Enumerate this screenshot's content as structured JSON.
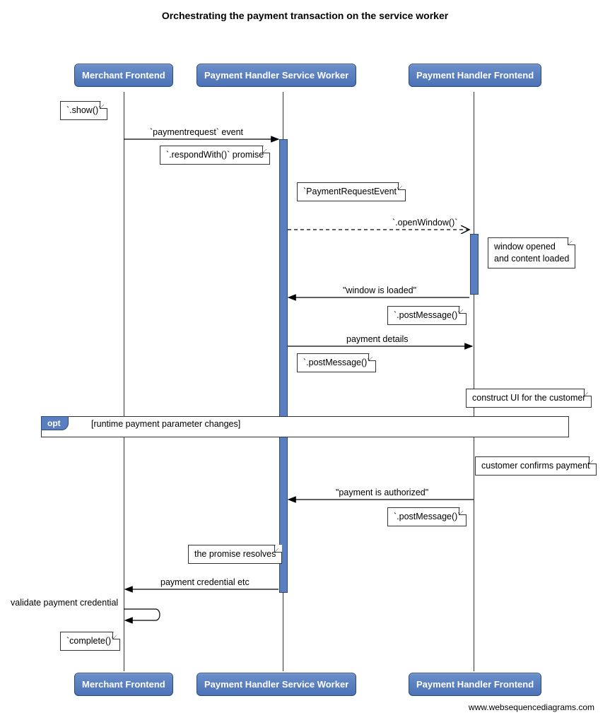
{
  "title": "Orchestrating the payment transaction on the service worker",
  "actors": {
    "merchant": "Merchant Frontend",
    "worker": "Payment Handler Service Worker",
    "frontend": "Payment Handler Frontend"
  },
  "notes": {
    "show": "`.show()`",
    "respondWith": "`.respondWith()` promise",
    "paymentRequestEvent": "`PaymentRequestEvent`",
    "windowOpened1": "window opened",
    "windowOpened2": "and content loaded",
    "postMsg1": "`.postMessage()`",
    "postMsg2": "`.postMessage()`",
    "constructUI": "construct UI for the customer",
    "customerConfirms": "customer confirms payment",
    "postMsg3": "`.postMessage()`",
    "promiseResolves": "the promise resolves",
    "complete": "`complete()`"
  },
  "messages": {
    "paymentRequestEvent": "`paymentrequest` event",
    "openWindow": "`.openWindow()`",
    "windowLoaded": "\"window is loaded\"",
    "paymentDetails": "payment details",
    "paymentAuthorized": "\"payment is authorized\"",
    "paymentCredential": "payment credential etc",
    "validate": "validate payment credential"
  },
  "frame": {
    "tag": "opt",
    "text": "[runtime payment parameter changes]"
  },
  "footer": "www.websequencediagrams.com"
}
